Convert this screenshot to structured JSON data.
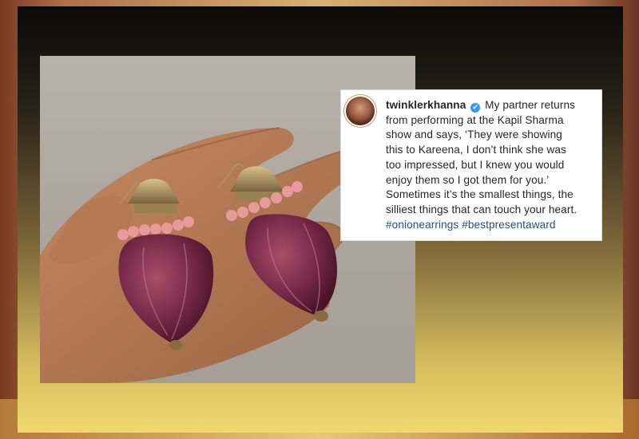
{
  "post": {
    "username": "twinklerkhanna",
    "verified_icon": "✔",
    "caption_lines": [
      "My partner returns",
      "from performing at the Kapil Sharma",
      "show and says, ‘They were showing",
      "this to Kareena, I don’t think she was",
      "too impressed, but I knew you would",
      "enjoy them so I got them for you.’",
      "Sometimes it’s the smallest things, the",
      "silliest things that can touch your heart."
    ],
    "hashtags": [
      "#onionearrings",
      "#bestpresentaward"
    ]
  },
  "photo": {
    "subject": "hand holding onion earrings"
  },
  "colors": {
    "hashtag": "#1d4f8c",
    "verified_badge": "#3897f0",
    "onion": "#7a2a4a",
    "bead": "#e89a9a"
  }
}
